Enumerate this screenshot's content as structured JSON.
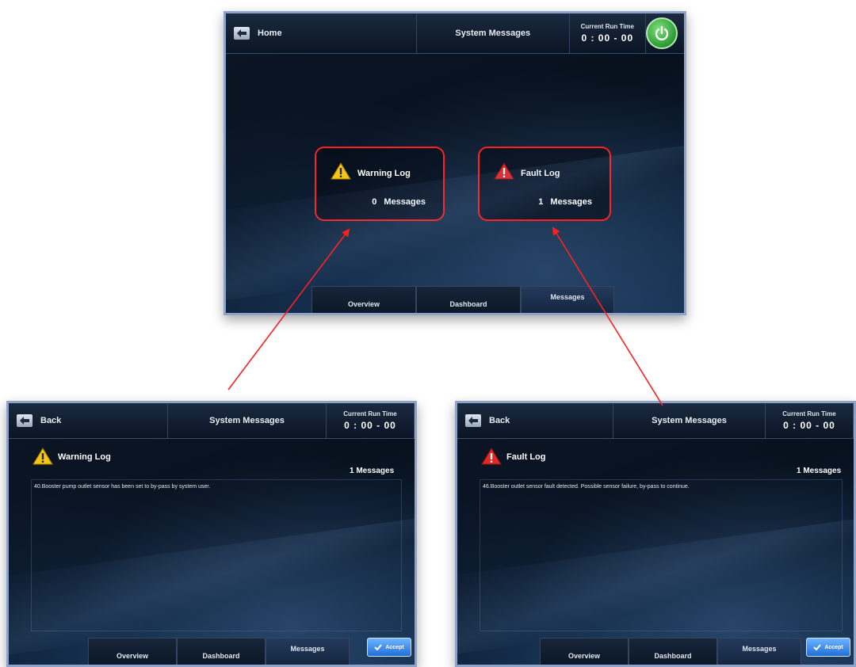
{
  "main_screen": {
    "nav_label": "Home",
    "title": "System Messages",
    "runtime_label": "Current Run Time",
    "runtime_value": "0 : 00 - 00",
    "warning_card": {
      "title": "Warning Log",
      "count": 0,
      "count_label": "Messages"
    },
    "fault_card": {
      "title": "Fault Log",
      "count": 1,
      "count_label": "Messages"
    },
    "tabs": [
      "Overview",
      "Dashboard",
      "Messages"
    ],
    "active_tab": "Messages"
  },
  "warning_screen": {
    "nav_label": "Back",
    "title": "System Messages",
    "runtime_label": "Current Run Time",
    "runtime_value": "0 : 00 - 00",
    "log_title": "Warning Log",
    "count_text": "1 Messages",
    "message": "40.Booster pump outlet sensor has been set to by-pass by system user.",
    "tabs": [
      "Overview",
      "Dashboard",
      "Messages"
    ],
    "accept_label": "Accept"
  },
  "fault_screen": {
    "nav_label": "Back",
    "title": "System Messages",
    "runtime_label": "Current Run Time",
    "runtime_value": "0 : 00 - 00",
    "log_title": "Fault Log",
    "count_text": "1 Messages",
    "message": "46.Booster outlet sensor fault detected. Possible sensor failure, by-pass to continue.",
    "tabs": [
      "Overview",
      "Dashboard",
      "Messages"
    ],
    "accept_label": "Accept"
  },
  "colors": {
    "highlight": "#ff2020",
    "warning": "#f5c518",
    "fault": "#e02828",
    "power": "#2e9a34",
    "accept": "#1f6fd8"
  }
}
